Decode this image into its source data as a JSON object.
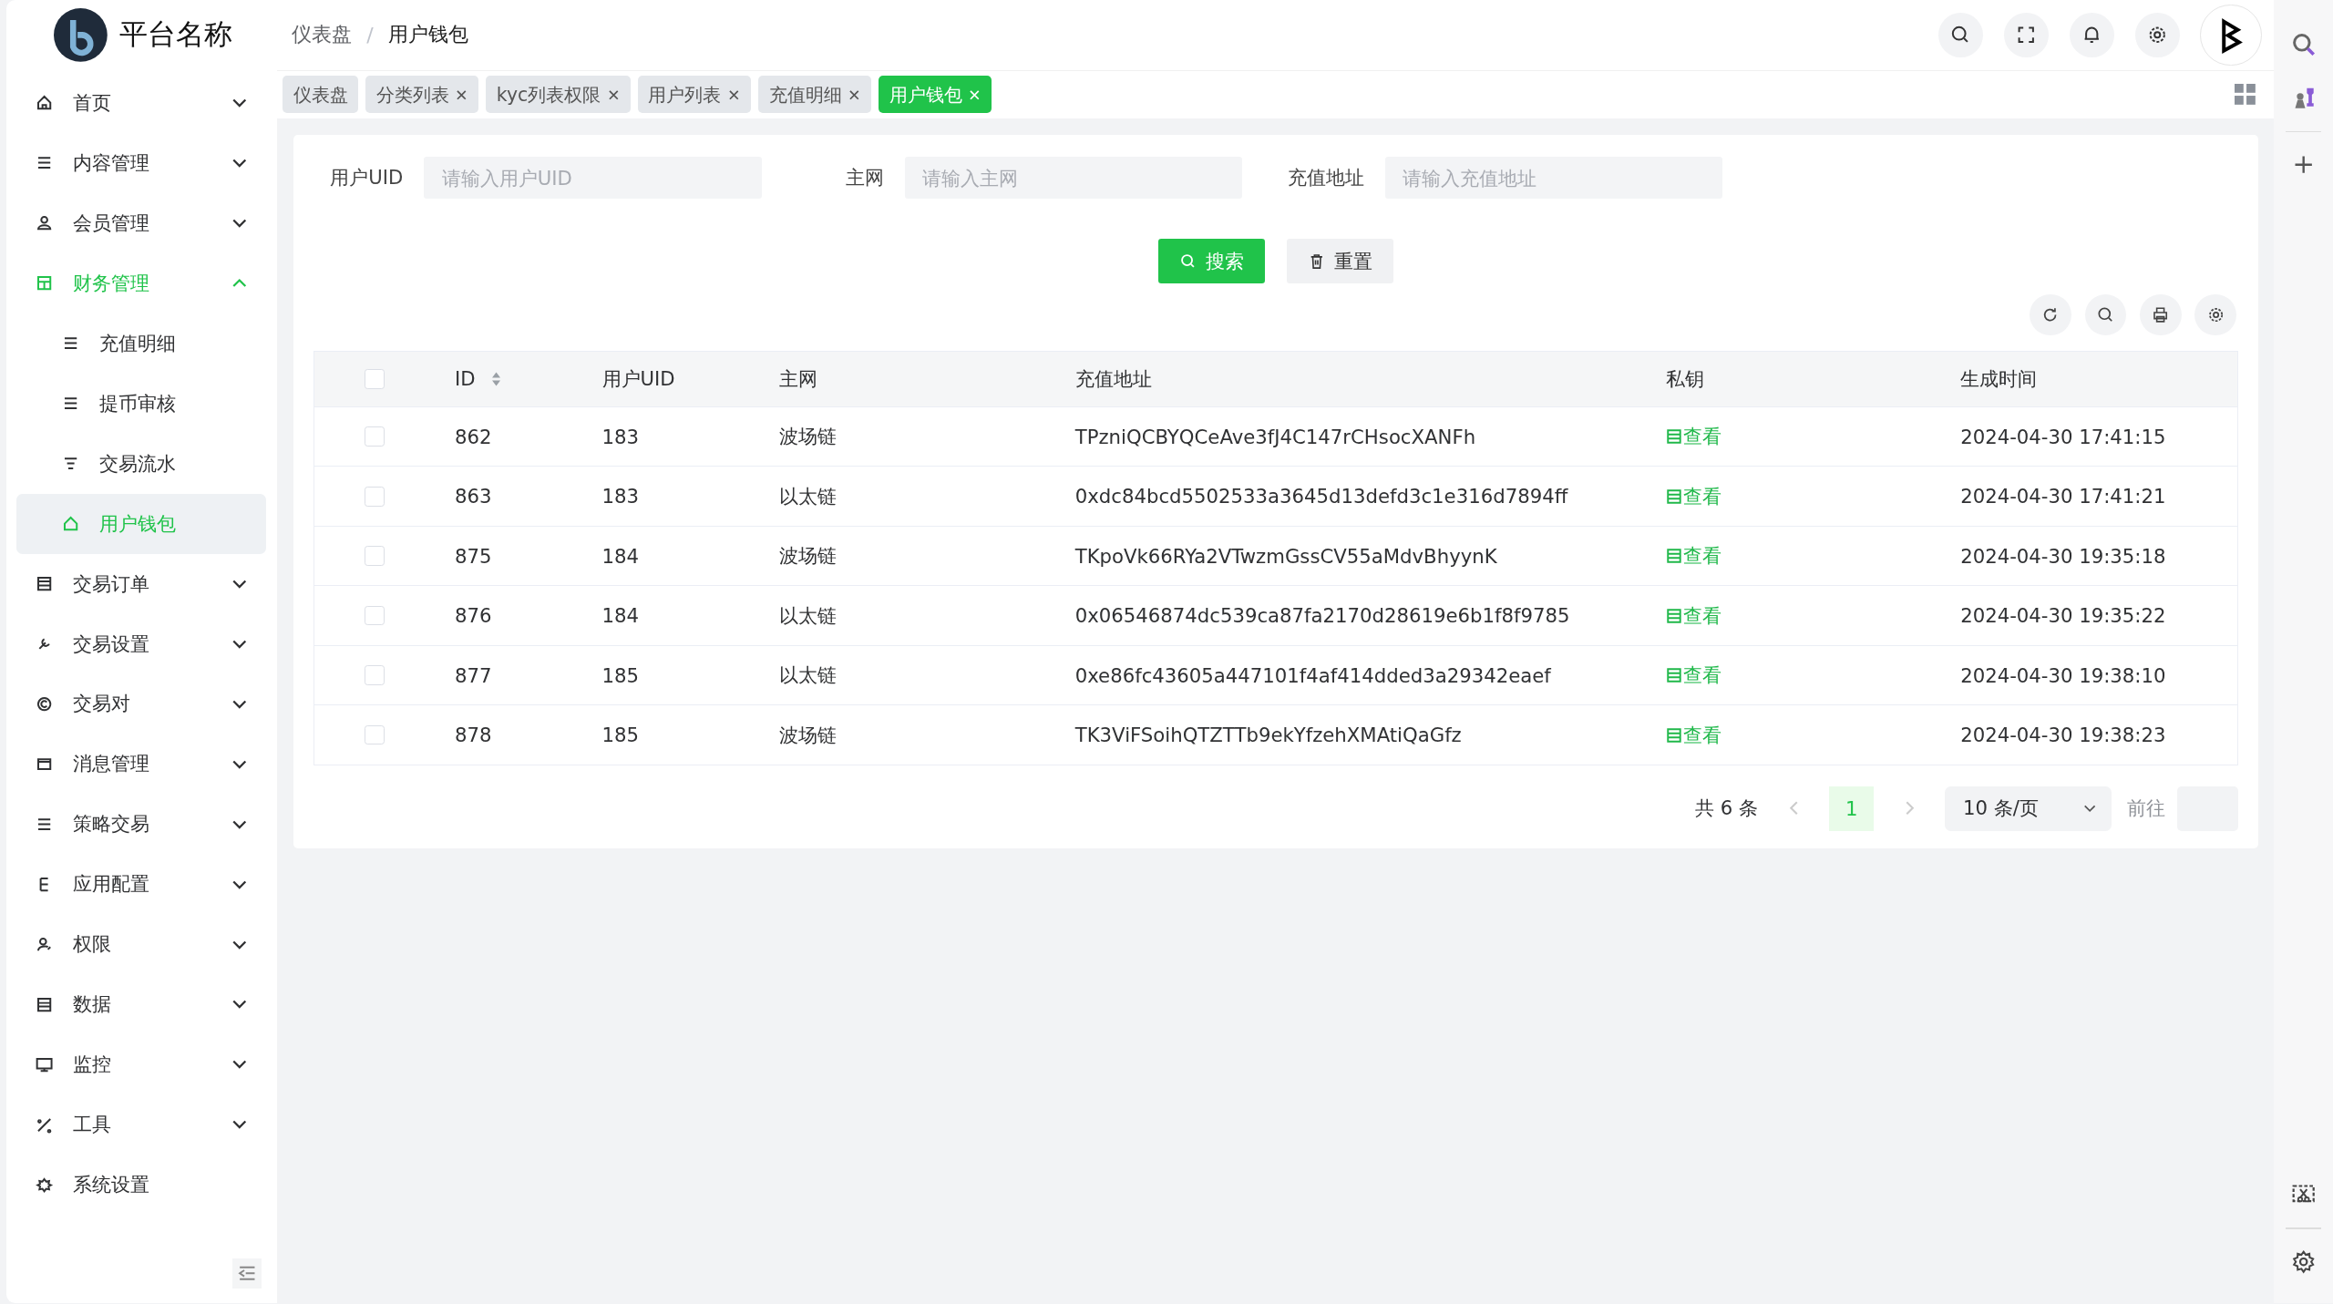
{
  "brand": {
    "name": "平台名称"
  },
  "breadcrumb": [
    "仪表盘",
    "用户钱包"
  ],
  "breadcrumb_separator": "/",
  "tabs": [
    {
      "label": "仪表盘",
      "closable": false,
      "selected": false
    },
    {
      "label": "分类列表",
      "closable": true,
      "selected": false
    },
    {
      "label": "kyc列表权限",
      "closable": true,
      "selected": false
    },
    {
      "label": "用户列表",
      "closable": true,
      "selected": false
    },
    {
      "label": "充值明细",
      "closable": true,
      "selected": false
    },
    {
      "label": "用户钱包",
      "closable": true,
      "selected": true
    }
  ],
  "sidebar": {
    "items": [
      {
        "label": "首页",
        "expanded": false,
        "selected": false,
        "has_children": true
      },
      {
        "label": "内容管理",
        "expanded": false,
        "selected": false,
        "has_children": true
      },
      {
        "label": "会员管理",
        "expanded": false,
        "selected": false,
        "has_children": true
      },
      {
        "label": "财务管理",
        "expanded": true,
        "selected": true,
        "has_children": true,
        "children": [
          {
            "label": "充值明细",
            "selected": false
          },
          {
            "label": "提币审核",
            "selected": false
          },
          {
            "label": "交易流水",
            "selected": false
          },
          {
            "label": "用户钱包",
            "selected": true
          }
        ]
      },
      {
        "label": "交易订单",
        "expanded": false,
        "selected": false,
        "has_children": true
      },
      {
        "label": "交易设置",
        "expanded": false,
        "selected": false,
        "has_children": true
      },
      {
        "label": "交易对",
        "expanded": false,
        "selected": false,
        "has_children": true
      },
      {
        "label": "消息管理",
        "expanded": false,
        "selected": false,
        "has_children": true
      },
      {
        "label": "策略交易",
        "expanded": false,
        "selected": false,
        "has_children": true
      },
      {
        "label": "应用配置",
        "expanded": false,
        "selected": false,
        "has_children": true
      },
      {
        "label": "权限",
        "expanded": false,
        "selected": false,
        "has_children": true
      },
      {
        "label": "数据",
        "expanded": false,
        "selected": false,
        "has_children": true
      },
      {
        "label": "监控",
        "expanded": false,
        "selected": false,
        "has_children": true
      },
      {
        "label": "工具",
        "expanded": false,
        "selected": false,
        "has_children": true
      },
      {
        "label": "系统设置",
        "selected": false,
        "has_children": false
      }
    ]
  },
  "filters": [
    {
      "label": "用户UID",
      "placeholder": "请输入用户UID"
    },
    {
      "label": "主网",
      "placeholder": "请输入主网"
    },
    {
      "label": "充值地址",
      "placeholder": "请输入充值地址"
    }
  ],
  "buttons": [
    {
      "label": "搜索",
      "kind": "primary"
    },
    {
      "label": "重置",
      "kind": "default"
    }
  ],
  "table": {
    "all_checked": false,
    "columns": [
      {
        "label": "ID",
        "sortable": true
      },
      {
        "label": "用户UID",
        "sortable": false
      },
      {
        "label": "主网",
        "sortable": false
      },
      {
        "label": "充值地址",
        "sortable": false
      },
      {
        "label": "私钥",
        "sortable": false
      },
      {
        "label": "生成时间",
        "sortable": false
      }
    ],
    "rows": [
      {
        "checked": false,
        "id": "862",
        "uid": "183",
        "network": "波场链",
        "address": "TPzniQCBYQCeAve3fJ4C147rCHsocXANFh",
        "key_link": "查看",
        "created": "2024-04-30 17:41:15"
      },
      {
        "checked": false,
        "id": "863",
        "uid": "183",
        "network": "以太链",
        "address": "0xdc84bcd5502533a3645d13defd3c1e316d7894ff",
        "key_link": "查看",
        "created": "2024-04-30 17:41:21"
      },
      {
        "checked": false,
        "id": "875",
        "uid": "184",
        "network": "波场链",
        "address": "TKpoVk66RYa2VTwzmGssCV55aMdvBhyynK",
        "key_link": "查看",
        "created": "2024-04-30 19:35:18"
      },
      {
        "checked": false,
        "id": "876",
        "uid": "184",
        "network": "以太链",
        "address": "0x06546874dc539ca87fa2170d28619e6b1f8f9785",
        "key_link": "查看",
        "created": "2024-04-30 19:35:22"
      },
      {
        "checked": false,
        "id": "877",
        "uid": "185",
        "network": "以太链",
        "address": "0xe86fc43605a447101f4af414dded3a29342eaef",
        "key_link": "查看",
        "created": "2024-04-30 19:38:10"
      },
      {
        "checked": false,
        "id": "878",
        "uid": "185",
        "network": "波场链",
        "address": "TK3ViFSoihQTZTTb9ekYfzehXMAtiQaGfz",
        "key_link": "查看",
        "created": "2024-04-30 19:38:23"
      }
    ]
  },
  "pagination": {
    "total": "共 6 条",
    "pages": [
      {
        "label": "1",
        "selected": true
      }
    ],
    "page_size": "10 条/页",
    "goto": "前往"
  }
}
